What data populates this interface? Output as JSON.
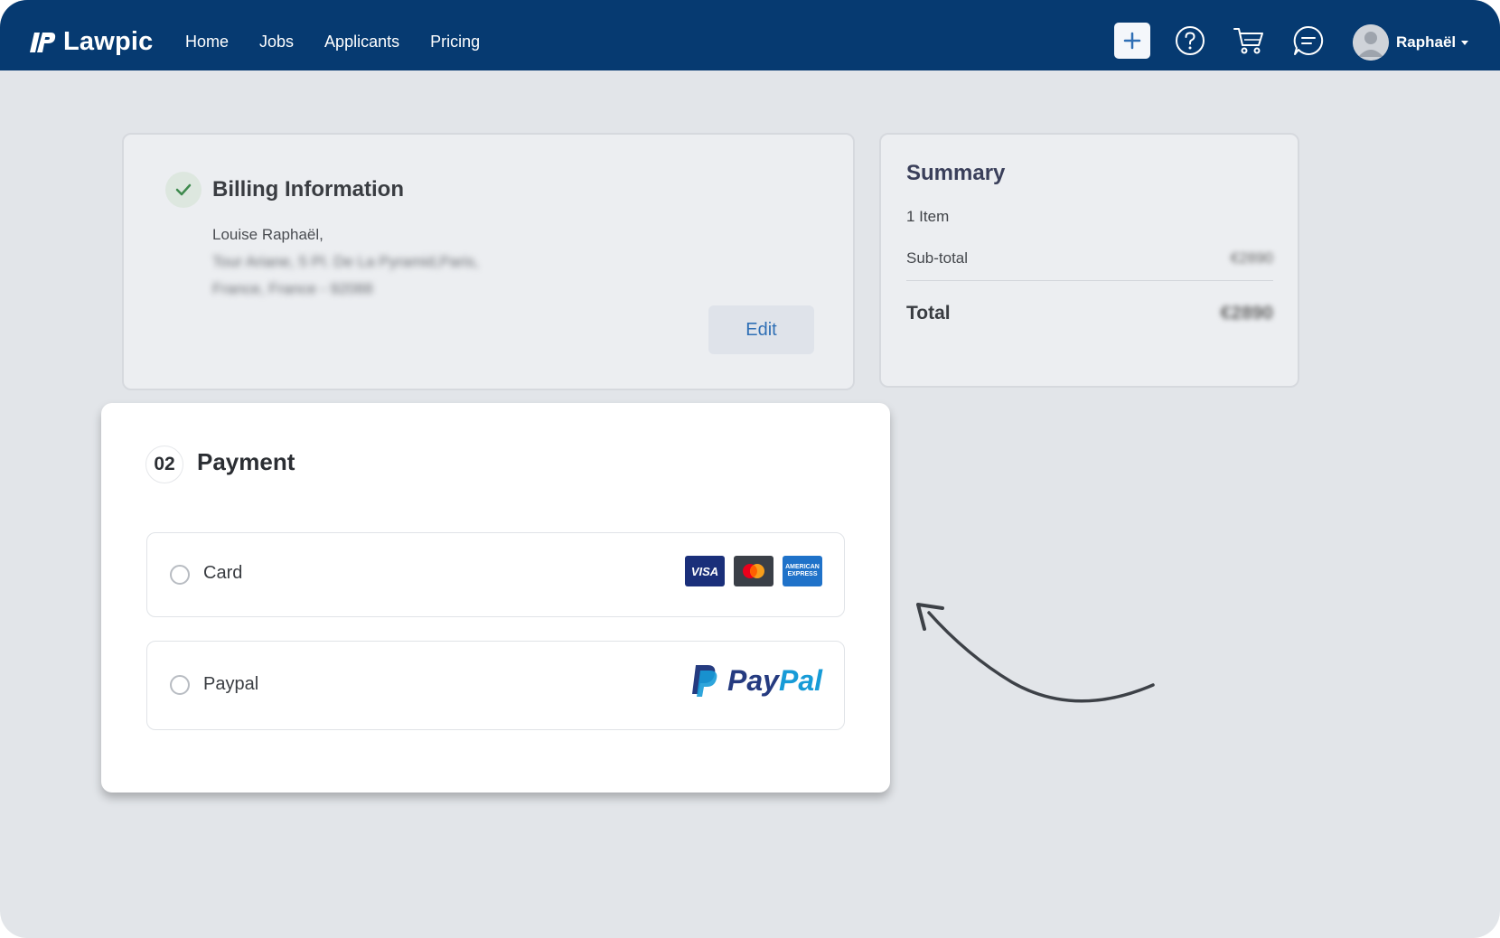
{
  "app": {
    "brand": "Lawpic",
    "nav": [
      "Home",
      "Jobs",
      "Applicants",
      "Pricing"
    ],
    "user_name": "Raphaël"
  },
  "billing": {
    "title": "Billing Information",
    "name": "Louise Raphaël,",
    "address_line1": "Tour Ariane, 5 Pl. De La Pyramid,Paris,",
    "address_line2": "France, France - 92088",
    "edit_label": "Edit"
  },
  "summary": {
    "title": "Summary",
    "items": "1 Item",
    "subtotal_label": "Sub-total",
    "subtotal_value": "€2890",
    "total_label": "Total",
    "total_value": "€2890"
  },
  "payment": {
    "step": "02",
    "title": "Payment",
    "options": [
      {
        "label": "Card",
        "selected": false
      },
      {
        "label": "Paypal",
        "selected": false
      }
    ],
    "card_brands": [
      "VISA",
      "AMERICAN EXPRESS"
    ],
    "paypal_brand": [
      "Pay",
      "Pal"
    ]
  },
  "colors": {
    "nav_bg": "#063a71",
    "accent": "#2f6fb5",
    "page_bg": "#e2e5e9"
  }
}
